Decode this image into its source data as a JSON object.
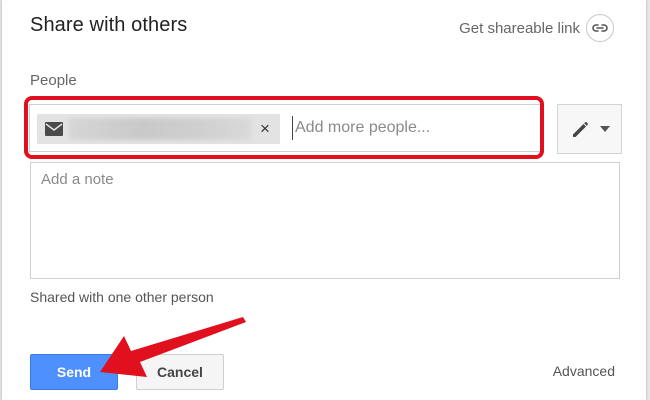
{
  "dialog": {
    "title": "Share with others",
    "share_link_label": "Get shareable link"
  },
  "people": {
    "label": "People",
    "chip": {
      "icon": "mail-icon",
      "name_redacted": true,
      "remove_label": "×"
    },
    "input_placeholder": "Add more people...",
    "permission": {
      "icon": "pencil-icon",
      "caret_icon": "caret-down-icon"
    }
  },
  "note": {
    "placeholder": "Add a note"
  },
  "shared_status": "Shared with one other person",
  "footer": {
    "send_label": "Send",
    "cancel_label": "Cancel",
    "advanced_label": "Advanced"
  },
  "colors": {
    "send_button": "#4d90fe",
    "annotation_red": "#e0101f"
  }
}
